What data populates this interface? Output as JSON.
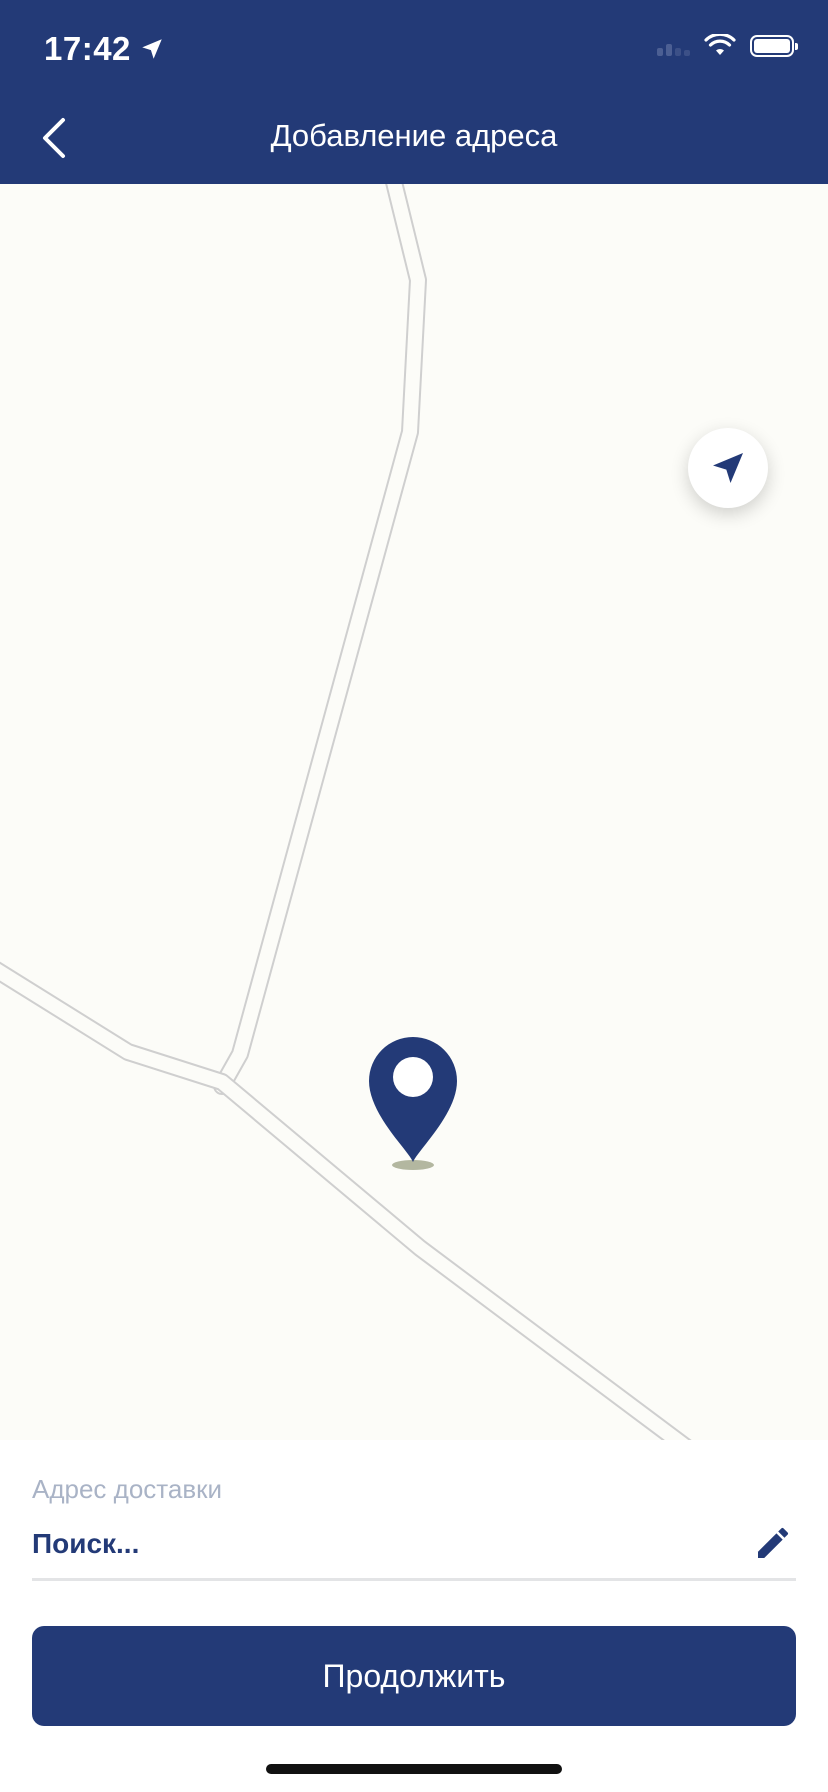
{
  "status_bar": {
    "time": "17:42",
    "icons": [
      "location-arrow-icon",
      "signal-icon",
      "wifi-icon",
      "battery-icon"
    ]
  },
  "header": {
    "title": "Добавление адреса",
    "back_icon": "chevron-left-icon"
  },
  "map": {
    "locate_icon": "navigation-arrow-icon",
    "pin_icon": "map-pin-icon"
  },
  "address": {
    "label": "Адрес доставки",
    "value": "Поиск...",
    "edit_icon": "pencil-icon"
  },
  "actions": {
    "continue_label": "Продолжить"
  },
  "colors": {
    "brand": "#233a77",
    "map_background": "#fcfcf8",
    "label_muted": "#a9b3c6"
  }
}
